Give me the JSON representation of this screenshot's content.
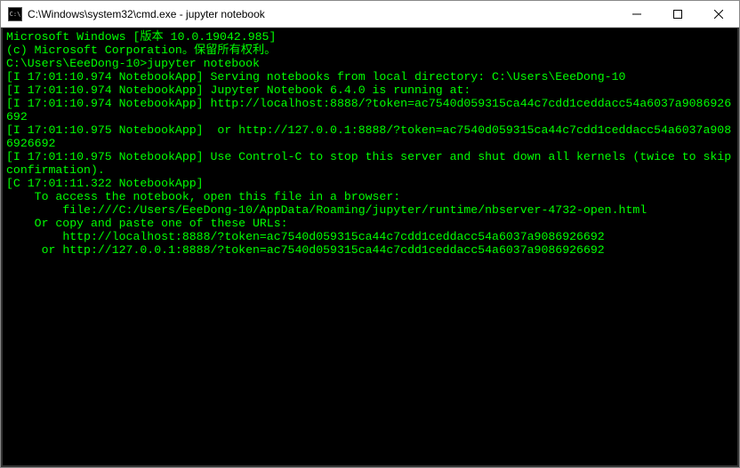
{
  "titlebar": {
    "icon_label": "C:\\",
    "title": "C:\\Windows\\system32\\cmd.exe - jupyter  notebook"
  },
  "console": {
    "lines": [
      "Microsoft Windows [版本 10.0.19042.985]",
      "(c) Microsoft Corporation。保留所有权利。",
      "",
      "C:\\Users\\EeeDong-10>jupyter notebook",
      "[I 17:01:10.974 NotebookApp] Serving notebooks from local directory: C:\\Users\\EeeDong-10",
      "[I 17:01:10.974 NotebookApp] Jupyter Notebook 6.4.0 is running at:",
      "[I 17:01:10.974 NotebookApp] http://localhost:8888/?token=ac7540d059315ca44c7cdd1ceddacc54a6037a9086926692",
      "[I 17:01:10.975 NotebookApp]  or http://127.0.0.1:8888/?token=ac7540d059315ca44c7cdd1ceddacc54a6037a9086926692",
      "[I 17:01:10.975 NotebookApp] Use Control-C to stop this server and shut down all kernels (twice to skip confirmation).",
      "[C 17:01:11.322 NotebookApp]",
      "",
      "    To access the notebook, open this file in a browser:",
      "        file:///C:/Users/EeeDong-10/AppData/Roaming/jupyter/runtime/nbserver-4732-open.html",
      "    Or copy and paste one of these URLs:",
      "        http://localhost:8888/?token=ac7540d059315ca44c7cdd1ceddacc54a6037a9086926692",
      "     or http://127.0.0.1:8888/?token=ac7540d059315ca44c7cdd1ceddacc54a6037a9086926692"
    ]
  }
}
